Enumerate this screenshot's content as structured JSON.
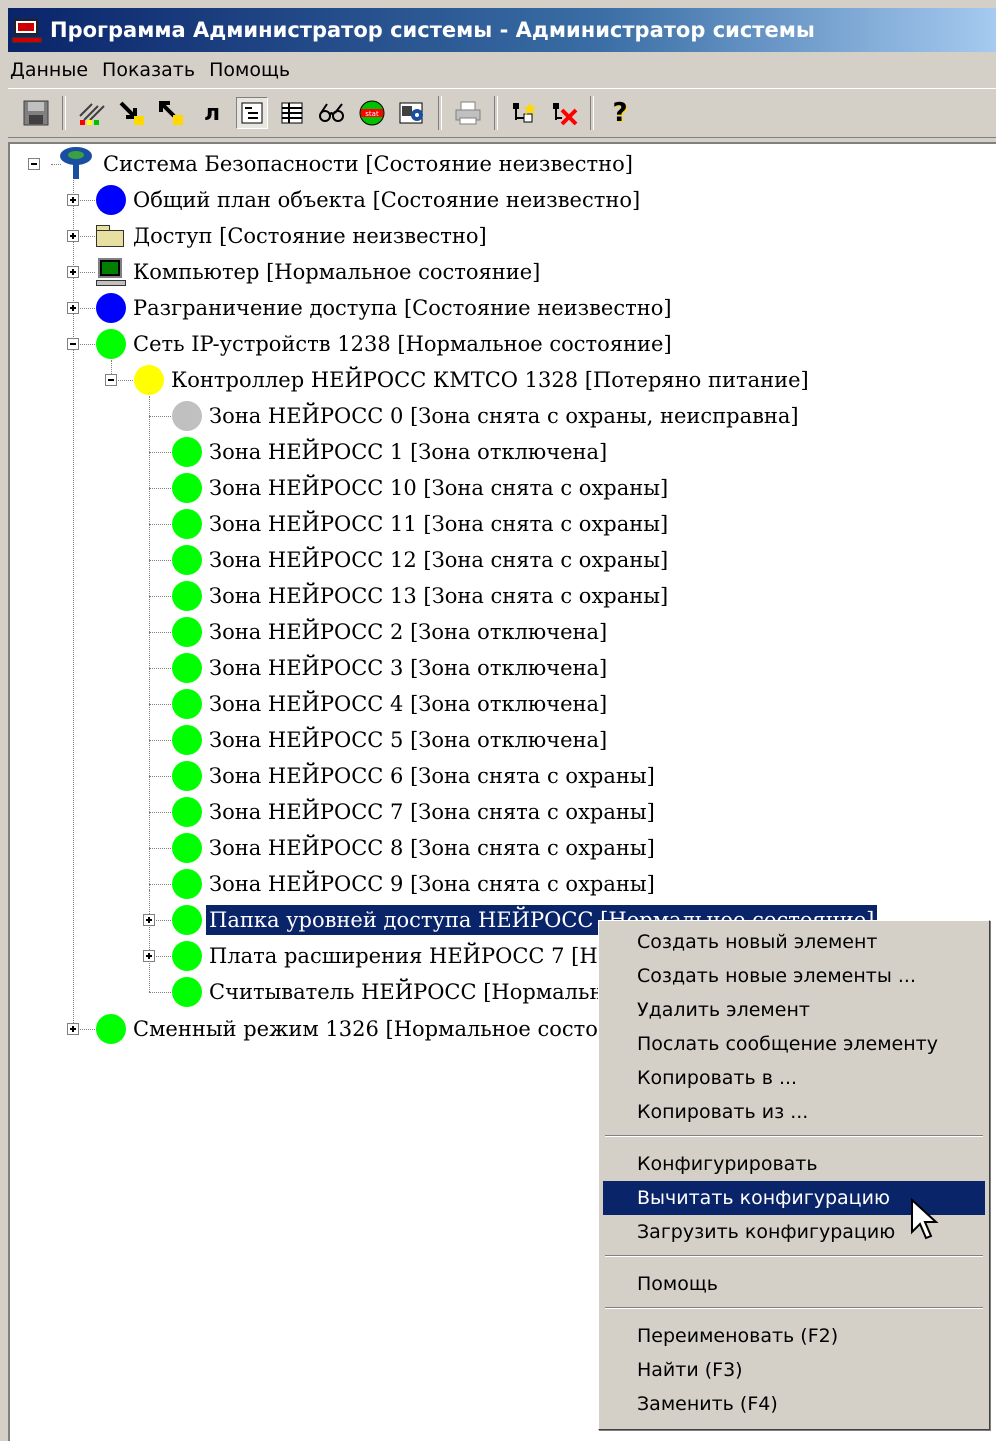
{
  "window": {
    "title": "Программа Администратор системы - Администратор системы"
  },
  "menubar": {
    "items": [
      "Данные",
      "Показать",
      "Помощь"
    ]
  },
  "toolbar": {
    "text_button": "л",
    "help_glyph": "?"
  },
  "tree": {
    "root": "Система Безопасности [Состояние неизвестно]",
    "level1": [
      "Общий план объекта [Состояние неизвестно]",
      "Доступ [Состояние неизвестно]",
      "Компьютер [Нормальное состояние]",
      "Разграничение доступа [Состояние неизвестно]",
      "Сеть IP-устройств 1238 [Нормальное состояние]"
    ],
    "controller": "Контроллер НЕЙРОСС КМТСО 1328 [Потеряно питание]",
    "zones": [
      "Зона НЕЙРОСС 0 [Зона снята с охраны, неисправна]",
      "Зона НЕЙРОСС 1 [Зона отключена]",
      "Зона НЕЙРОСС 10 [Зона снята с охраны]",
      "Зона НЕЙРОСС 11 [Зона снята с охраны]",
      "Зона НЕЙРОСС 12 [Зона снята с охраны]",
      "Зона НЕЙРОСС 13 [Зона снята с охраны]",
      "Зона НЕЙРОСС 2 [Зона отключена]",
      "Зона НЕЙРОСС 3 [Зона отключена]",
      "Зона НЕЙРОСС 4 [Зона отключена]",
      "Зона НЕЙРОСС 5 [Зона отключена]",
      "Зона НЕЙРОСС 6 [Зона снята с охраны]",
      "Зона НЕЙРОСС 7 [Зона снята с охраны]",
      "Зона НЕЙРОСС 8 [Зона снята с охраны]",
      "Зона НЕЙРОСС 9 [Зона снята с охраны]"
    ],
    "folder_selected": "Папка уровней доступа НЕЙРОСС [Нормальное состояние]",
    "expansion_board": "Плата расширения НЕЙРОСС 7 [Нормальное состояние]",
    "reader": "Считыватель НЕЙРОСС [Нормальное состояние]",
    "shift_mode": "Сменный режим 1326 [Нормальное состояние]"
  },
  "context_menu": {
    "group1": [
      "Создать новый элемент",
      "Создать новые элементы ...",
      "Удалить элемент",
      "Послать сообщение элементу",
      "Копировать в ...",
      "Копировать из ..."
    ],
    "group2": [
      "Конфигурировать",
      "Вычитать конфигурацию",
      "Загрузить конфигурацию"
    ],
    "group3": [
      "Помощь"
    ],
    "group4": [
      "Переименовать (F2)",
      "Найти (F3)",
      "Заменить (F4)"
    ],
    "highlighted": "Вычитать конфигурацию"
  },
  "colors": {
    "selection": "#0a246a",
    "status_unknown": "#0000ff",
    "status_normal": "#00ff00",
    "status_power_lost": "#ffff00",
    "status_faulty": "#c0c0c0"
  }
}
